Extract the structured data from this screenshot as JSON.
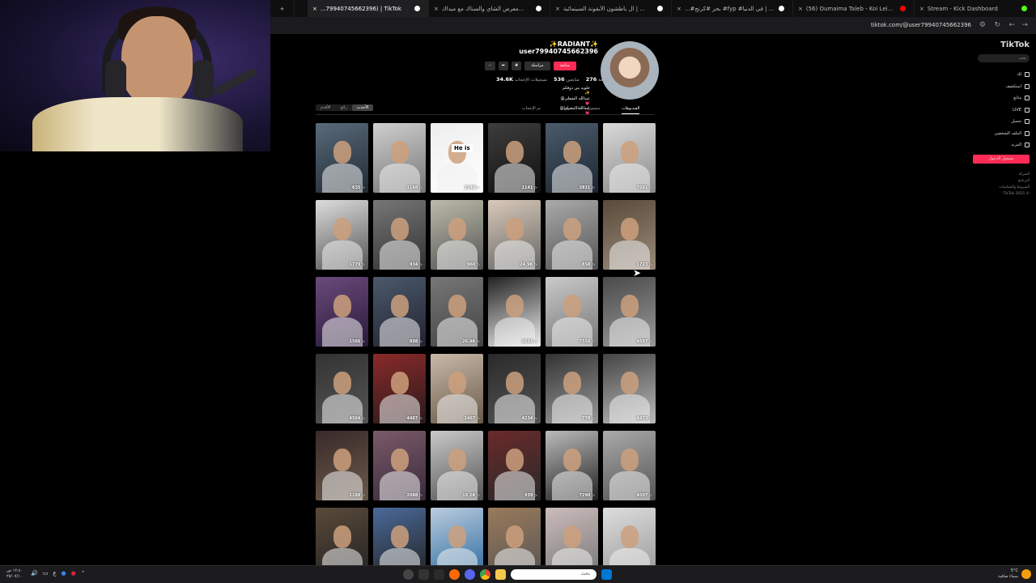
{
  "browser": {
    "tabs": [
      {
        "label": "Stream - Kick Dashboard",
        "fav": "#53fc18"
      },
      {
        "label": "(56) Oumaima Taleb - Koi Lei...",
        "fav": "#ff0000"
      },
      {
        "label": "...#بحر #كرنج #fyp #فى الدنيا | ...",
        "fav": "#ffffff"
      },
      {
        "label": "ال باطشون الأيقونة السينمائية | ...",
        "fav": "#ffffff"
      },
      {
        "label": "معرض الشاي والسناك مع ميداك...",
        "fav": "#ffffff"
      },
      {
        "label": "...79940745662396) | TikTok",
        "fav": "#ffffff",
        "active": true
      }
    ],
    "new_tab": "+",
    "url": "tiktok.com/@user79940745662396"
  },
  "sidebar": {
    "logo": "TikTok",
    "search_placeholder": "بحث",
    "items": [
      {
        "label": "لك",
        "icon": "home-icon"
      },
      {
        "label": "استكشف",
        "icon": "compass-icon"
      },
      {
        "label": "متابع",
        "icon": "following-icon"
      },
      {
        "label": "LIVE",
        "icon": "live-icon"
      },
      {
        "label": "تحميل",
        "icon": "upload-icon"
      },
      {
        "label": "الملف الشخصي",
        "icon": "profile-icon"
      },
      {
        "label": "المزيد",
        "icon": "more-icon"
      }
    ],
    "login": "تسجيل الدخول",
    "footer": [
      "الشركة",
      "البرنامج",
      "الشروط والسياسات",
      "TikTok 2025 ©"
    ]
  },
  "profile": {
    "username": "✨RADIANT✨ user79940745662396",
    "follow": "متابعة",
    "message": "مراسلة",
    "share_icon": "share-icon",
    "more_icon": "more-icon",
    "stats": [
      {
        "value": "276",
        "label": "متابعة"
      },
      {
        "value": "536",
        "label": "متابعين"
      },
      {
        "value": "34.6K",
        "label": "تسجيلات الإعجاب"
      }
    ],
    "bio": [
      "حلويه من ذوقكم ✨",
      "@عبدالله الشعلي 💗",
      "@عبدالله المحيلي 💗"
    ]
  },
  "content_tabs": {
    "sort": [
      "الأحدث",
      "رائج",
      "الأقدم"
    ],
    "tabs": [
      "الفيديوهات",
      "منشورات معاد نشرها",
      "تم الإعجاب"
    ]
  },
  "videos": [
    {
      "views": "7681"
    },
    {
      "views": "3831"
    },
    {
      "views": "1141"
    },
    {
      "views": "1148",
      "caption": "He is"
    },
    {
      "views": "1168"
    },
    {
      "views": "635"
    },
    {
      "views": "1713"
    },
    {
      "views": "858"
    },
    {
      "views": "24.9K"
    },
    {
      "views": "960"
    },
    {
      "views": "934"
    },
    {
      "views": "1779"
    },
    {
      "views": "4697"
    },
    {
      "views": "7554"
    },
    {
      "views": "2691"
    },
    {
      "views": "26.4K"
    },
    {
      "views": "898"
    },
    {
      "views": "1566"
    },
    {
      "views": "4433"
    },
    {
      "views": "778"
    },
    {
      "views": "4234"
    },
    {
      "views": "1467"
    },
    {
      "views": "4487"
    },
    {
      "views": "4564"
    },
    {
      "views": "4507"
    },
    {
      "views": "7290"
    },
    {
      "views": "939"
    },
    {
      "views": "19.2K"
    },
    {
      "views": "2088"
    },
    {
      "views": "2288"
    },
    {
      "views": ""
    },
    {
      "views": ""
    },
    {
      "views": ""
    },
    {
      "views": ""
    },
    {
      "views": ""
    },
    {
      "views": ""
    }
  ],
  "taskbar": {
    "search": "بحث",
    "date_time": [
      "١٢:٤٠ ص",
      "٢٥/٠٧/١٠"
    ],
    "weather": [
      "5°C",
      "سماء صافية"
    ],
    "lang": "ع"
  }
}
